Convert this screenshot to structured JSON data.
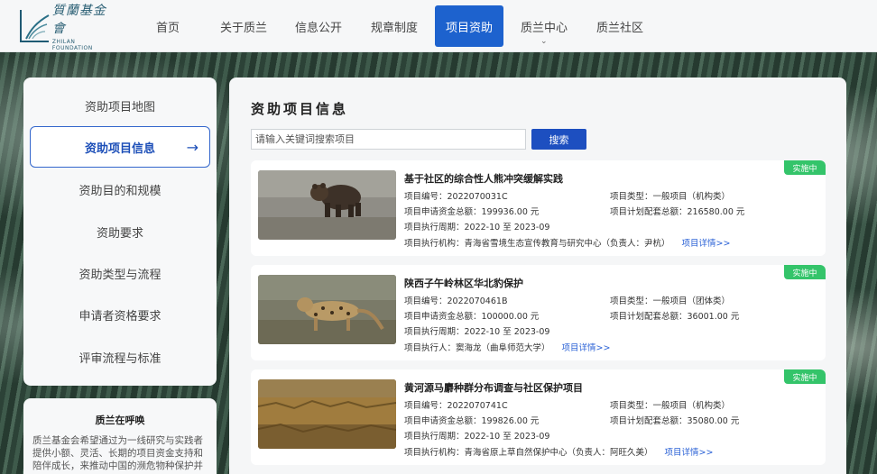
{
  "brand": {
    "name_cn": "質蘭基金會",
    "name_en": "ZHILAN FOUNDATION"
  },
  "nav": {
    "items": [
      {
        "label": "首页"
      },
      {
        "label": "关于质兰"
      },
      {
        "label": "信息公开"
      },
      {
        "label": "规章制度"
      },
      {
        "label": "项目资助"
      },
      {
        "label": "质兰中心"
      },
      {
        "label": "质兰社区"
      }
    ],
    "active_index": 4
  },
  "sidebar": {
    "items": [
      {
        "label": "资助项目地图"
      },
      {
        "label": "资助项目信息"
      },
      {
        "label": "资助目的和规模"
      },
      {
        "label": "资助要求"
      },
      {
        "label": "资助类型与流程"
      },
      {
        "label": "申请者资格要求"
      },
      {
        "label": "评审流程与标准"
      }
    ],
    "active_index": 1
  },
  "callout": {
    "title": "质兰在呼唤",
    "body": "质兰基金会希望通过为一线研究与实践者提供小额、灵活、长期的项目资金支持和陪伴成长，来推动中国的濒危物种保护并"
  },
  "main": {
    "title": "资助项目信息",
    "search_placeholder": "请输入关键词搜索项目",
    "search_button": "搜索"
  },
  "projects": [
    {
      "status": "实施中",
      "title": "基于社区的综合性人熊冲突缓解实践",
      "id_line": "项目编号：2022070031C",
      "type_line": "项目类型：一般项目（机构类）",
      "amount_line": "项目申请资金总额：199936.00 元",
      "match_line": "项目计划配套总额：216580.00 元",
      "period_line": "项目执行周期：2022-10 至 2023-09",
      "org_line": "项目执行机构：青海省雪境生态宣传教育与研究中心（负责人：尹杭）",
      "detail_link": "项目详情>>",
      "image_icon": "bear-photo"
    },
    {
      "status": "实施中",
      "title": "陕西子午岭林区华北豹保护",
      "id_line": "项目编号：2022070461B",
      "type_line": "项目类型：一般项目（团体类）",
      "amount_line": "项目申请资金总额：100000.00 元",
      "match_line": "项目计划配套总额：36001.00 元",
      "period_line": "项目执行周期：2022-10 至 2023-09",
      "org_line": "项目执行人：窦海龙（曲阜师范大学）",
      "detail_link": "项目详情>>",
      "image_icon": "leopard-photo"
    },
    {
      "status": "实施中",
      "title": "黄河源马麝种群分布调查与社区保护项目",
      "id_line": "项目编号：2022070741C",
      "type_line": "项目类型：一般项目（机构类）",
      "amount_line": "项目申请资金总额：199826.00 元",
      "match_line": "项目计划配套总额：35080.00 元",
      "period_line": "项目执行周期：2022-10 至 2023-09",
      "org_line": "项目执行机构：青海省原上草自然保护中心（负责人：阿旺久美）",
      "detail_link": "项目详情>>",
      "image_icon": "grassland-photo"
    }
  ],
  "colors": {
    "nav_active": "#1d62ce",
    "accent_blue": "#1d4fc0",
    "status_green": "#34c46a",
    "link_blue": "#2b62d6"
  }
}
